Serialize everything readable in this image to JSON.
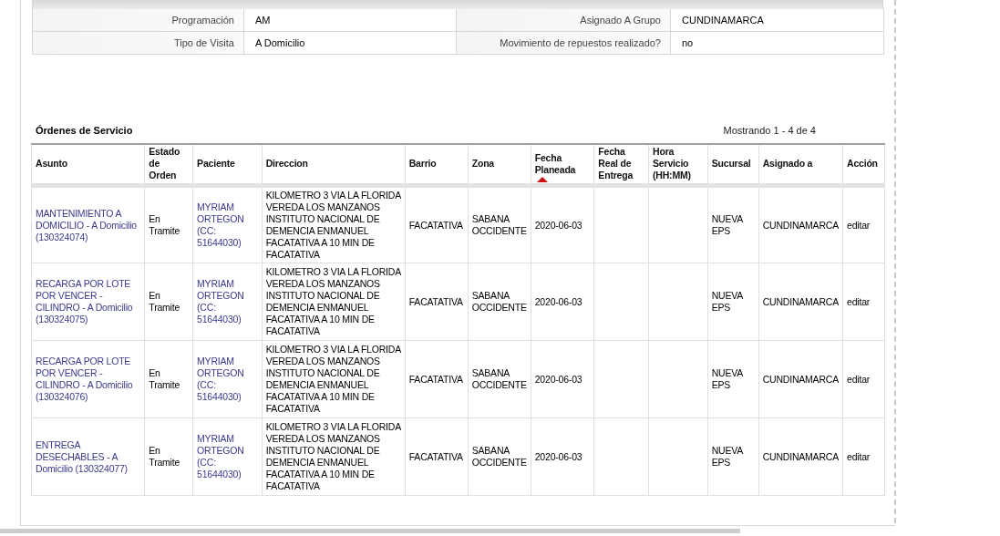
{
  "details": [
    {
      "label": "Programación",
      "value": "AM"
    },
    {
      "label": "Asignado A Grupo",
      "value": "CUNDINAMARCA"
    },
    {
      "label": "Tipo de Visita",
      "value": "A Domicilio"
    },
    {
      "label": "Movimiento de repuestos realizado?",
      "value": "no"
    }
  ],
  "orders": {
    "title": "Órdenes de Servicio",
    "pagination": "Mostrando 1 - 4 de 4",
    "columns": [
      {
        "label": "Asunto",
        "sorted": false
      },
      {
        "label": "Estado de Orden",
        "sorted": false
      },
      {
        "label": "Paciente",
        "sorted": false
      },
      {
        "label": "Direccion",
        "sorted": false
      },
      {
        "label": "Barrio",
        "sorted": false
      },
      {
        "label": "Zona",
        "sorted": false
      },
      {
        "label": "Fecha Planeada",
        "sorted": true
      },
      {
        "label": "Fecha Real de Entrega",
        "sorted": false
      },
      {
        "label": "Hora Servicio (HH:MM)",
        "sorted": false
      },
      {
        "label": "Sucursal",
        "sorted": false
      },
      {
        "label": "Asignado a",
        "sorted": false
      },
      {
        "label": "Acción",
        "sorted": false
      }
    ],
    "rows": [
      [
        "MANTENIMIENTO A DOMICILIO - A Domicilio (130324074)",
        "En Tramite",
        "MYRIAM ORTEGON (CC: 51644030)",
        "KILOMETRO 3 VIA LA FLORIDA VEREDA LOS MANZANOS INSTITUTO NACIONAL DE DEMENCIA ENMANUEL FACATATIVA A 10 MIN DE FACATATIVA",
        "FACATATIVA",
        "SABANA OCCIDENTE",
        "2020-06-03",
        "",
        "",
        "NUEVA EPS",
        "CUNDINAMARCA",
        "editar"
      ],
      [
        "RECARGA POR LOTE POR VENCER - CILINDRO - A Domicilio (130324075)",
        "En Tramite",
        "MYRIAM ORTEGON (CC: 51644030)",
        "KILOMETRO 3 VIA LA FLORIDA VEREDA LOS MANZANOS INSTITUTO NACIONAL DE DEMENCIA ENMANUEL FACATATIVA A 10 MIN DE FACATATIVA",
        "FACATATIVA",
        "SABANA OCCIDENTE",
        "2020-06-03",
        "",
        "",
        "NUEVA EPS",
        "CUNDINAMARCA",
        "editar"
      ],
      [
        "RECARGA POR LOTE POR VENCER - CILINDRO - A Domicilio (130324076)",
        "En Tramite",
        "MYRIAM ORTEGON (CC: 51644030)",
        "KILOMETRO 3 VIA LA FLORIDA VEREDA LOS MANZANOS INSTITUTO NACIONAL DE DEMENCIA ENMANUEL FACATATIVA A 10 MIN DE FACATATIVA",
        "FACATATIVA",
        "SABANA OCCIDENTE",
        "2020-06-03",
        "",
        "",
        "NUEVA EPS",
        "CUNDINAMARCA",
        "editar"
      ],
      [
        "ENTREGA DESECHABLES - A Domicilio (130324077)",
        "En Tramite",
        "MYRIAM ORTEGON (CC: 51644030)",
        "KILOMETRO 3 VIA LA FLORIDA VEREDA LOS MANZANOS INSTITUTO NACIONAL DE DEMENCIA ENMANUEL FACATATIVA A 10 MIN DE FACATATIVA",
        "FACATATIVA",
        "SABANA OCCIDENTE",
        "2020-06-03",
        "",
        "",
        "NUEVA EPS",
        "CUNDINAMARCA",
        "editar"
      ]
    ]
  }
}
